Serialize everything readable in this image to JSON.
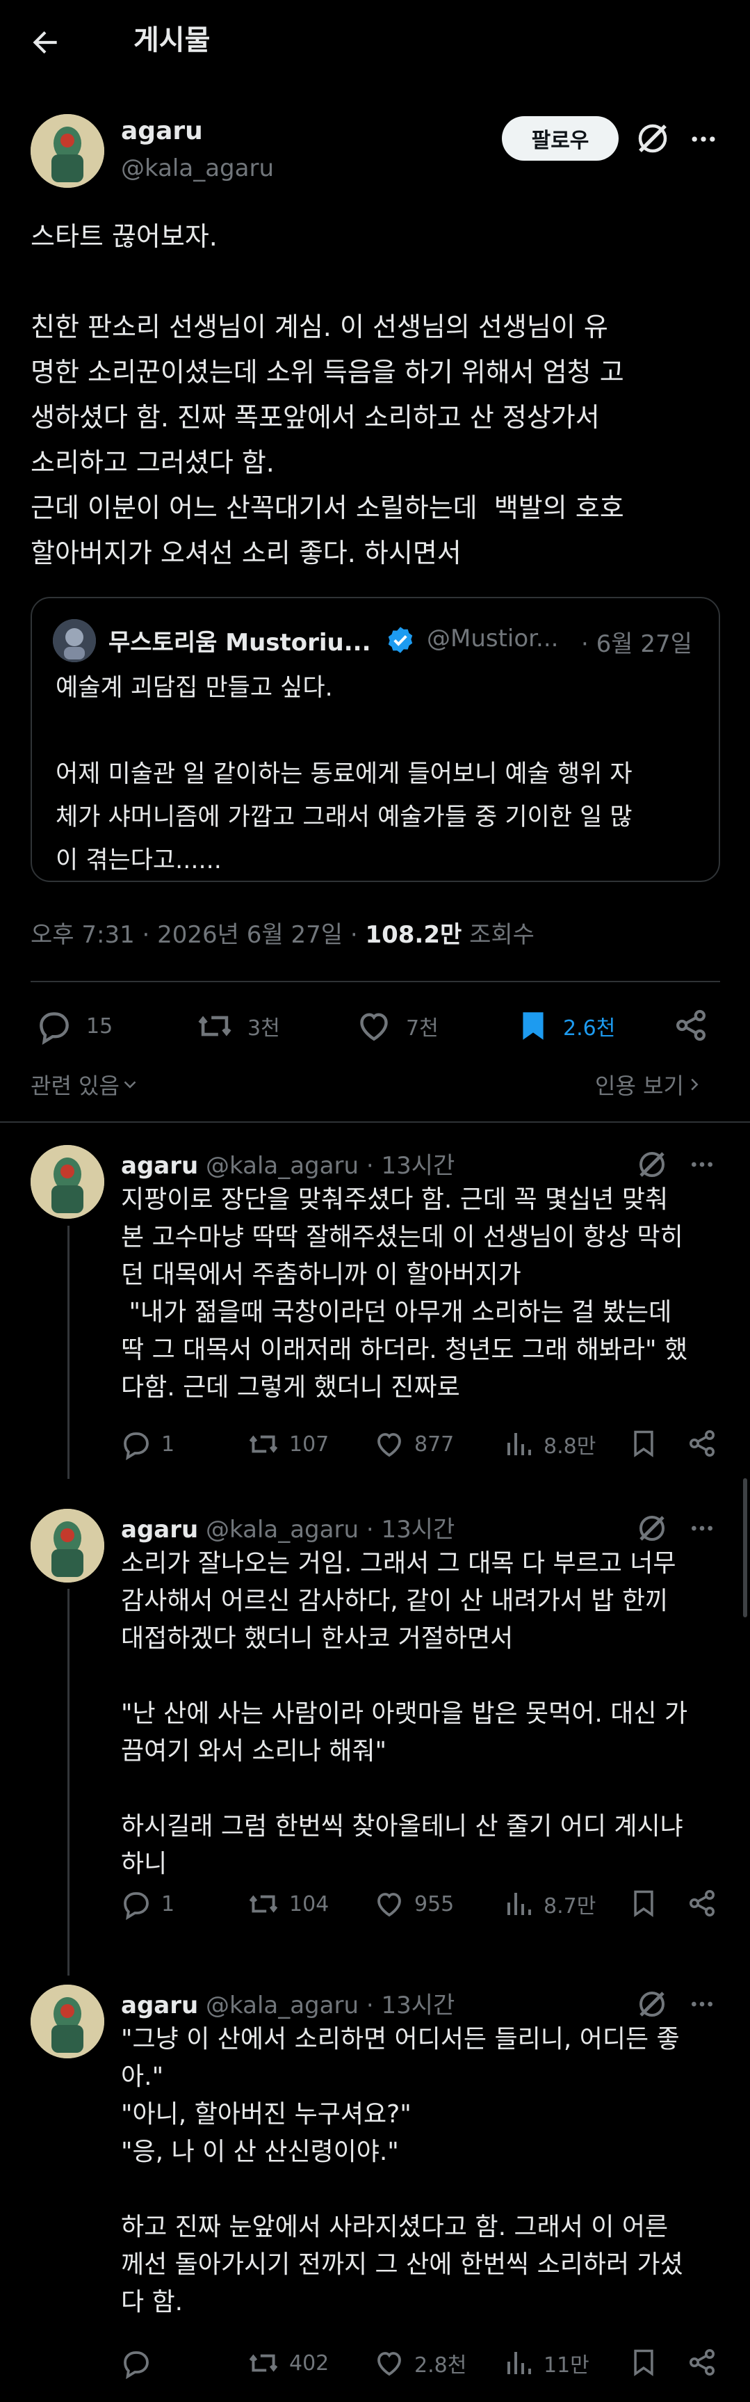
{
  "header": {
    "title": "게시물"
  },
  "post": {
    "display_name": "agaru",
    "handle": "@kala_agaru",
    "follow_label": "팔로우",
    "text": "스타트 끊어보자.\n\n친한 판소리 선생님이 계심. 이 선생님의 선생님이 유\n명한 소리꾼이셨는데 소위 득음을 하기 위해서 엄청 고\n생하셨다 함. 진짜 폭포앞에서 소리하고 산 정상가서\n소리하고 그러셨다 함.\n근데 이분이 어느 산꼭대기서 소릴하는데  백발의 호호\n할아버지가 오셔선 소리 좋다. 하시면서",
    "quote": {
      "display_name": "무스토리움 Mustoriu...",
      "handle": "@Mustior...",
      "date": "· 6월 27일",
      "text": "예술계 괴담집 만들고 싶다.\n\n어제 미술관 일 같이하는 동료에게 들어보니 예술 행위 자\n체가 샤머니즘에 가깝고 그래서 예술가들 중 기이한 일 많\n이 겪는다고......"
    },
    "time": "오후 7:31 · 2026년 6월 27일 · ",
    "views_count": "108.2만",
    "views_label": " 조회수",
    "stats": {
      "replies": "15",
      "reposts": "3천",
      "likes": "7천",
      "bookmarks": "2.6천"
    },
    "related_label": "관련 있음",
    "quotes_label": "인용 보기"
  },
  "replies": [
    {
      "display_name": "agaru",
      "handle": "@kala_agaru",
      "time": "· 13시간",
      "text": "지팡이로 장단을 맞춰주셨다 함. 근데 꼭 몇십년 맞춰\n본 고수마냥 딱딱 잘해주셨는데 이 선생님이 항상 막히\n던 대목에서 주춤하니까 이 할아버지가\n \"내가 젊을때 국창이라던 아무개 소리하는 걸 봤는데\n딱 그 대목서 이래저래 하더라. 청년도 그래 해봐라\" 했\n다함. 근데 그렇게 했더니 진짜로",
      "replies": "1",
      "reposts": "107",
      "likes": "877",
      "views": "8.8만"
    },
    {
      "display_name": "agaru",
      "handle": "@kala_agaru",
      "time": "· 13시간",
      "text": "소리가 잘나오는 거임. 그래서 그 대목 다 부르고 너무\n감사해서 어르신 감사하다, 같이 산 내려가서 밥 한끼\n대접하겠다 했더니 한사코 거절하면서\n\n\"난 산에 사는 사람이라 아랫마을 밥은 못먹어. 대신 가\n끔여기 와서 소리나 해줘\"\n\n하시길래 그럼 한번씩 찾아올테니 산 줄기 어디 계시냐\n하니",
      "replies": "1",
      "reposts": "104",
      "likes": "955",
      "views": "8.7만"
    },
    {
      "display_name": "agaru",
      "handle": "@kala_agaru",
      "time": "· 13시간",
      "text": "\"그냥 이 산에서 소리하면 어디서든 들리니, 어디든 좋\n아.\"\n\"아니, 할아버진 누구셔요?\"\n\"응, 나 이 산 산신령이야.\"\n\n하고 진짜 눈앞에서 사라지셨다고 함. 그래서 이 어른\n께선 돌아가시기 전까지 그 산에 한번씩 소리하러 가셨\n다 함.",
      "replies": "",
      "reposts": "402",
      "likes": "2.8천",
      "views": "11만"
    }
  ],
  "colors": {
    "accent": "#1d9bf0",
    "muted": "#71767b",
    "text": "#e7e9ea",
    "verified": "#1d9bf0"
  }
}
